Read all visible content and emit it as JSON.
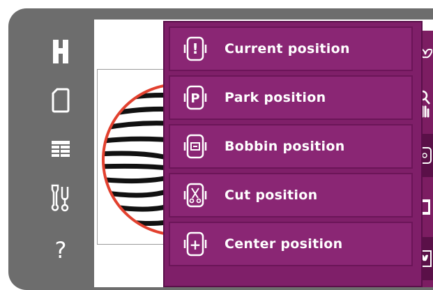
{
  "sidebar": {
    "items": [
      {
        "name": "home-icon"
      },
      {
        "name": "design-area-icon"
      },
      {
        "name": "list-view-icon"
      },
      {
        "name": "tools-icon"
      },
      {
        "name": "help-icon",
        "glyph": "?"
      }
    ]
  },
  "menu": {
    "items": [
      {
        "label": "Current position",
        "icon": "current-position-icon",
        "icon_glyph": "!"
      },
      {
        "label": "Park position",
        "icon": "park-position-icon",
        "icon_glyph": "P"
      },
      {
        "label": "Bobbin position",
        "icon": "bobbin-position-icon"
      },
      {
        "label": "Cut position",
        "icon": "cut-position-icon"
      },
      {
        "label": "Center position",
        "icon": "center-position-icon",
        "icon_glyph": "+"
      }
    ]
  },
  "right_toolbar": {
    "items": [
      {
        "name": "butterfly-design-icon"
      },
      {
        "name": "zoom-pan-icon"
      },
      {
        "name": "position-icon"
      },
      {
        "name": "frame-icon"
      },
      {
        "name": "butterfly-frame-icon"
      }
    ]
  },
  "colors": {
    "device": "#6d6d6d",
    "menu": "#7f1f69",
    "menu_item": "#8a2674",
    "hoop_ring": "#e2412f",
    "text": "#ffffff"
  }
}
